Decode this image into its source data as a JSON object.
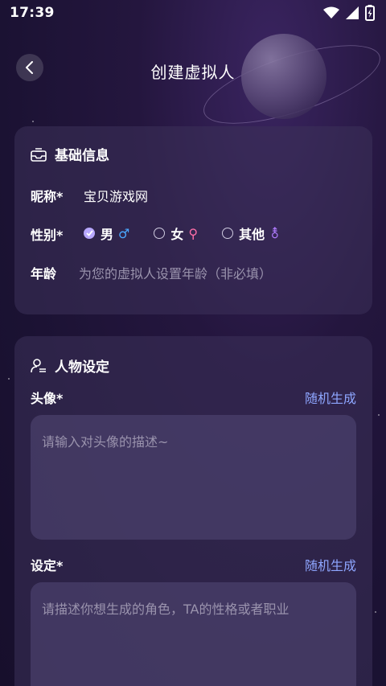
{
  "status_bar": {
    "time": "17:39"
  },
  "header": {
    "title": "创建虚拟人"
  },
  "basic_info": {
    "section_title": "基础信息",
    "nickname_label": "昵称*",
    "nickname_value": "宝贝游戏网",
    "gender_label": "性别*",
    "gender_options": [
      {
        "label": "男",
        "symbol": "♂",
        "color": "#4aa8ff",
        "selected": true
      },
      {
        "label": "女",
        "symbol": "⚲",
        "color": "#ff6fa8",
        "selected": false
      },
      {
        "label": "其他",
        "symbol": "⚨",
        "color": "#b07cff",
        "selected": false
      }
    ],
    "age_label": "年龄",
    "age_placeholder": "为您的虚拟人设置年龄（非必填）"
  },
  "persona": {
    "section_title": "人物设定",
    "avatar_label": "头像*",
    "avatar_generate": "随机生成",
    "avatar_placeholder": "请输入对头像的描述~",
    "setting_label": "设定*",
    "setting_generate": "随机生成",
    "setting_placeholder": "请描述你想生成的角色，TA的性格或者职业"
  }
}
